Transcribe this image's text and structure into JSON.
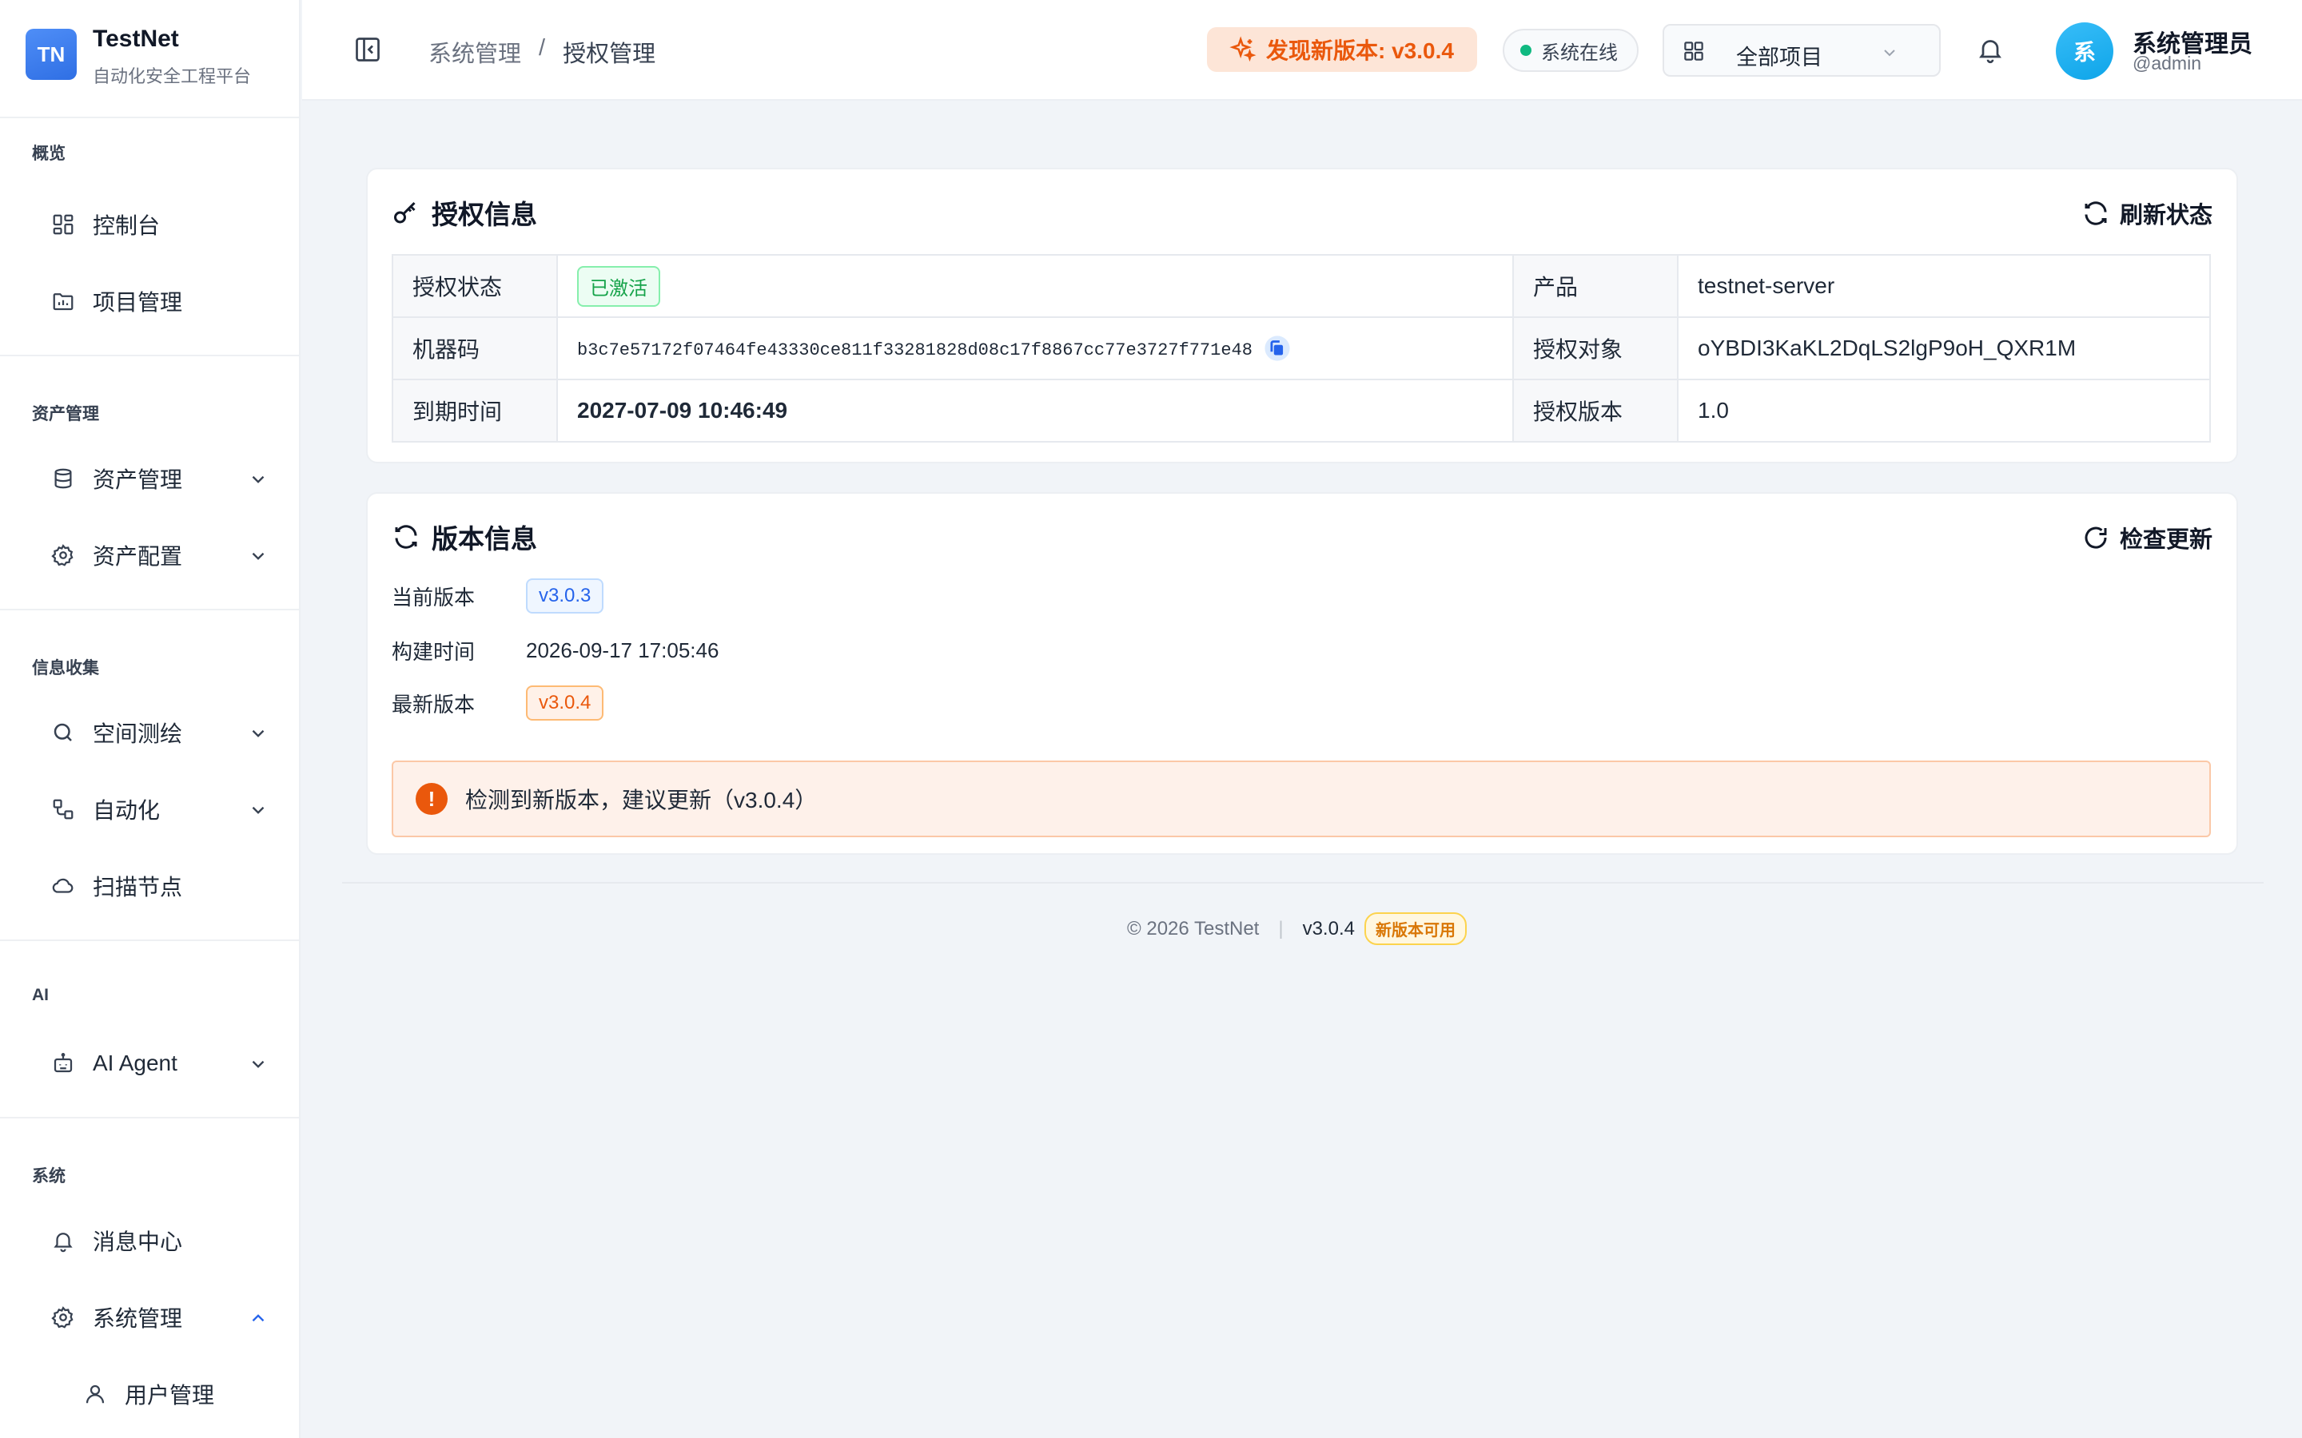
{
  "brand": {
    "logo": "TN",
    "name": "TestNet",
    "subtitle": "自动化安全工程平台"
  },
  "sidebar": {
    "groups": [
      {
        "title": "概览",
        "items": [
          {
            "label": "控制台",
            "icon": "dashboard-icon"
          },
          {
            "label": "项目管理",
            "icon": "folder-icon"
          }
        ]
      },
      {
        "title": "资产管理",
        "items": [
          {
            "label": "资产管理",
            "icon": "database-icon",
            "expandable": true
          },
          {
            "label": "资产配置",
            "icon": "gear-icon",
            "expandable": true
          }
        ]
      },
      {
        "title": "信息收集",
        "items": [
          {
            "label": "空间测绘",
            "icon": "search-icon",
            "expandable": true
          },
          {
            "label": "自动化",
            "icon": "workflow-icon",
            "expandable": true
          },
          {
            "label": "扫描节点",
            "icon": "cloud-icon"
          }
        ]
      },
      {
        "title": "AI",
        "items": [
          {
            "label": "AI Agent",
            "icon": "robot-icon",
            "expandable": true
          }
        ]
      },
      {
        "title": "系统",
        "items": [
          {
            "label": "消息中心",
            "icon": "bell-icon"
          },
          {
            "label": "系统管理",
            "icon": "gear-icon",
            "expandable": true,
            "expanded": true
          },
          {
            "label": "用户管理",
            "icon": "user-icon",
            "sub": true
          }
        ]
      }
    ]
  },
  "header": {
    "breadcrumb": [
      "系统管理",
      "授权管理"
    ],
    "breadcrumb_sep": "/",
    "update_badge": "发现新版本: v3.0.4",
    "status": "系统在线",
    "project_select": "全部项目",
    "user": {
      "avatar": "系",
      "name": "系统管理员",
      "handle": "@admin"
    }
  },
  "license": {
    "title": "授权信息",
    "action": "刷新状态",
    "rows": [
      {
        "k1": "授权状态",
        "v1": "已激活",
        "k2": "产品",
        "v2": "testnet-server"
      },
      {
        "k1": "机器码",
        "v1": "b3c7e57172f07464fe43330ce811f33281828d08c17f8867cc77e3727f771e48",
        "k2": "授权对象",
        "v2": "oYBDI3KaKL2DqLS2lgP9oH_QXR1M"
      },
      {
        "k1": "到期时间",
        "v1": "2027-07-09 10:46:49",
        "k2": "授权版本",
        "v2": "1.0"
      }
    ]
  },
  "version": {
    "title": "版本信息",
    "action": "检查更新",
    "current_label": "当前版本",
    "current": "v3.0.3",
    "build_label": "构建时间",
    "build": "2026-09-17 17:05:46",
    "latest_label": "最新版本",
    "latest": "v3.0.4",
    "alert_icon": "!",
    "alert": "检测到新版本，建议更新（v3.0.4）"
  },
  "footer": {
    "copyright": "© 2026 TestNet",
    "sep": "|",
    "version": "v3.0.4",
    "new_badge": "新版本可用"
  },
  "colors": {
    "accent": "#2563eb",
    "warning": "#ea580c",
    "success": "#16a34a",
    "online": "#10b981"
  }
}
